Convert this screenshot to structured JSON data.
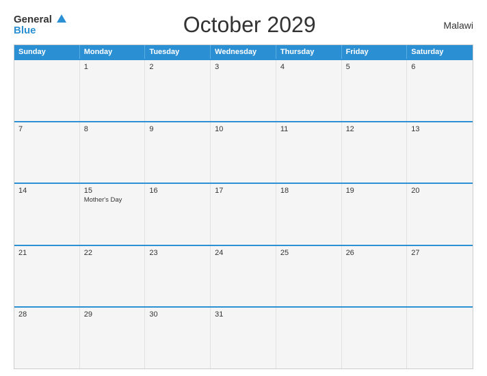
{
  "header": {
    "logo_general": "General",
    "logo_blue": "Blue",
    "title": "October 2029",
    "country": "Malawi"
  },
  "day_headers": [
    "Sunday",
    "Monday",
    "Tuesday",
    "Wednesday",
    "Thursday",
    "Friday",
    "Saturday"
  ],
  "weeks": [
    [
      {
        "num": "",
        "event": ""
      },
      {
        "num": "1",
        "event": ""
      },
      {
        "num": "2",
        "event": ""
      },
      {
        "num": "3",
        "event": ""
      },
      {
        "num": "4",
        "event": ""
      },
      {
        "num": "5",
        "event": ""
      },
      {
        "num": "6",
        "event": ""
      }
    ],
    [
      {
        "num": "7",
        "event": ""
      },
      {
        "num": "8",
        "event": ""
      },
      {
        "num": "9",
        "event": ""
      },
      {
        "num": "10",
        "event": ""
      },
      {
        "num": "11",
        "event": ""
      },
      {
        "num": "12",
        "event": ""
      },
      {
        "num": "13",
        "event": ""
      }
    ],
    [
      {
        "num": "14",
        "event": ""
      },
      {
        "num": "15",
        "event": "Mother's Day"
      },
      {
        "num": "16",
        "event": ""
      },
      {
        "num": "17",
        "event": ""
      },
      {
        "num": "18",
        "event": ""
      },
      {
        "num": "19",
        "event": ""
      },
      {
        "num": "20",
        "event": ""
      }
    ],
    [
      {
        "num": "21",
        "event": ""
      },
      {
        "num": "22",
        "event": ""
      },
      {
        "num": "23",
        "event": ""
      },
      {
        "num": "24",
        "event": ""
      },
      {
        "num": "25",
        "event": ""
      },
      {
        "num": "26",
        "event": ""
      },
      {
        "num": "27",
        "event": ""
      }
    ],
    [
      {
        "num": "28",
        "event": ""
      },
      {
        "num": "29",
        "event": ""
      },
      {
        "num": "30",
        "event": ""
      },
      {
        "num": "31",
        "event": ""
      },
      {
        "num": "",
        "event": ""
      },
      {
        "num": "",
        "event": ""
      },
      {
        "num": "",
        "event": ""
      }
    ]
  ]
}
